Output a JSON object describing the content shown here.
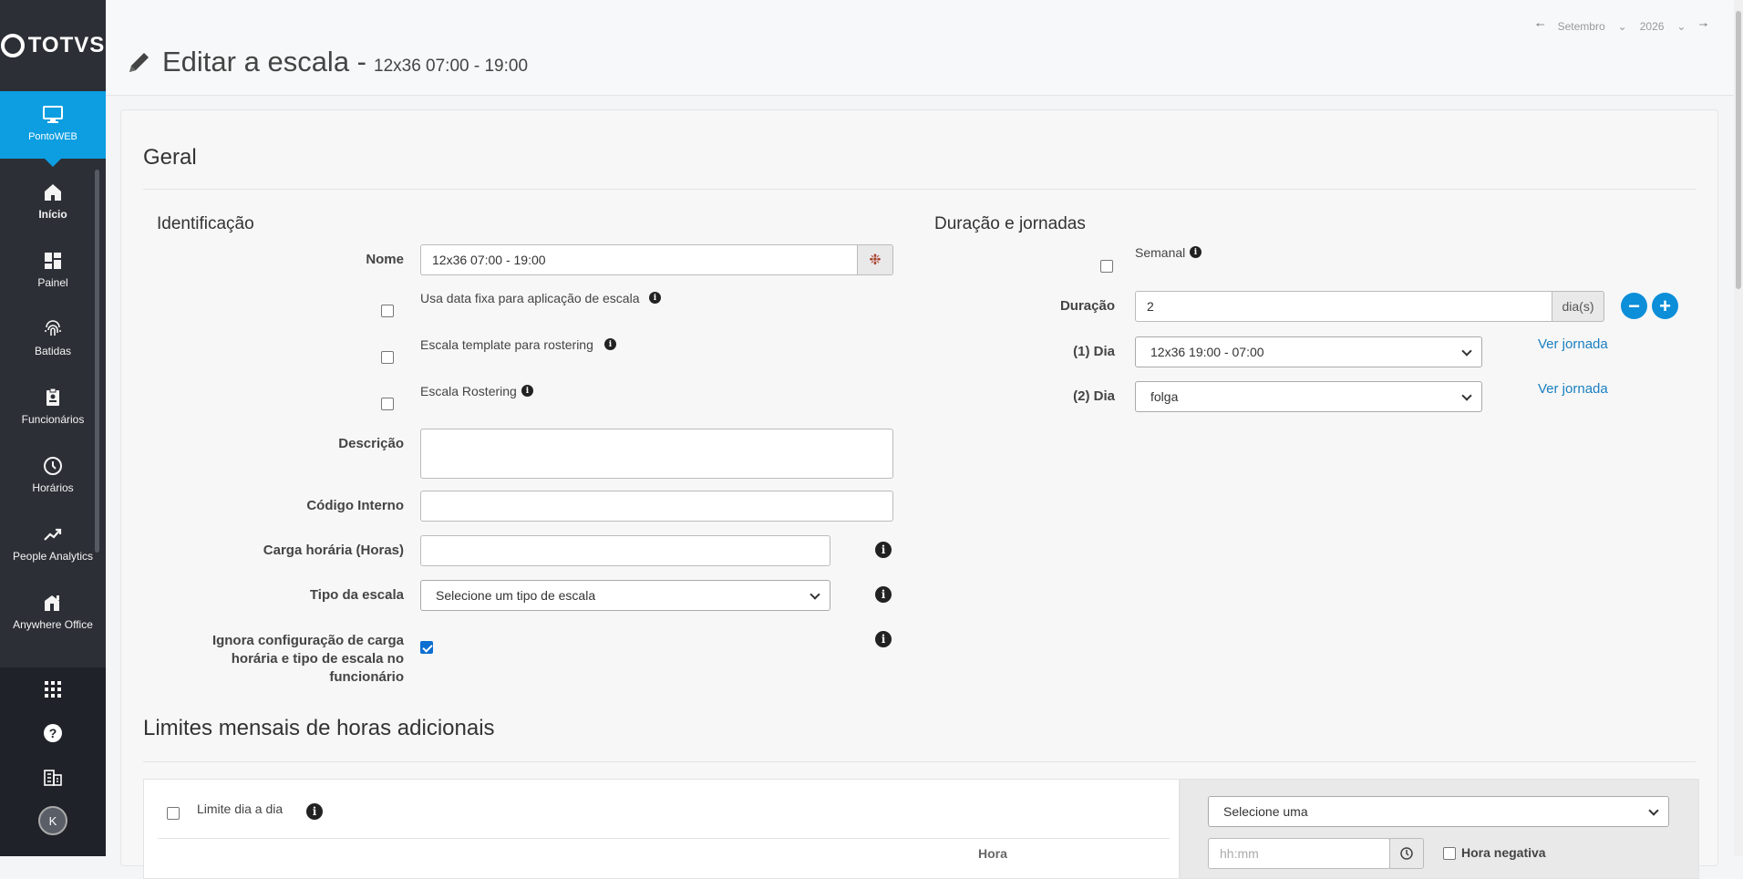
{
  "brand": {
    "logo_text": "TOTVS",
    "accent": "#0c9ee0"
  },
  "sidebar": {
    "app": {
      "label": "PontoWEB",
      "icon": "monitor-icon"
    },
    "items": [
      {
        "label": "Início",
        "icon": "home-icon"
      },
      {
        "label": "Painel",
        "icon": "dashboard-icon"
      },
      {
        "label": "Batidas",
        "icon": "fingerprint-icon"
      },
      {
        "label": "Funcionários",
        "icon": "badge-icon"
      },
      {
        "label": "Horários",
        "icon": "clock-icon"
      },
      {
        "label": "People Analytics",
        "icon": "trend-icon"
      },
      {
        "label": "Anywhere Office",
        "icon": "office-icon"
      }
    ],
    "avatar_initial": "K"
  },
  "header": {
    "title": "Editar a escala -",
    "subtitle": "12x36 07:00 - 19:00",
    "month": "Setembro",
    "year": "2026"
  },
  "geral": {
    "section_title": "Geral",
    "identificacao": {
      "title": "Identificação",
      "nome_label": "Nome",
      "nome_value": "12x36 07:00 - 19:00",
      "data_fixa_label": "Usa data fixa para aplicação de escala",
      "template_label": "Escala template para rostering",
      "rostering_label": "Escala Rostering",
      "descricao_label": "Descrição",
      "codigo_label": "Código Interno",
      "carga_label": "Carga horária (Horas)",
      "tipo_label": "Tipo da escala",
      "tipo_value": "Selecione um tipo de escala",
      "ignora_label": "Ignora configuração de carga horária e tipo de escala no funcionário"
    },
    "duracao": {
      "title": "Duração e jornadas",
      "semanal_label": "Semanal",
      "duracao_label": "Duração",
      "duracao_value": "2",
      "duracao_unit": "dia(s)",
      "dias": [
        {
          "label": "(1) Dia",
          "value": "12x36 19:00 - 07:00",
          "link": "Ver jornada"
        },
        {
          "label": "(2) Dia",
          "value": "folga",
          "link": "Ver jornada"
        }
      ]
    }
  },
  "limites": {
    "section_title": "Limites mensais de horas adicionais",
    "dia_a_dia_label": "Limite dia a dia",
    "hora_header": "Hora",
    "select_value": "Selecione uma",
    "hhmm_placeholder": "hh:mm",
    "hora_negativa_label": "Hora negativa"
  }
}
